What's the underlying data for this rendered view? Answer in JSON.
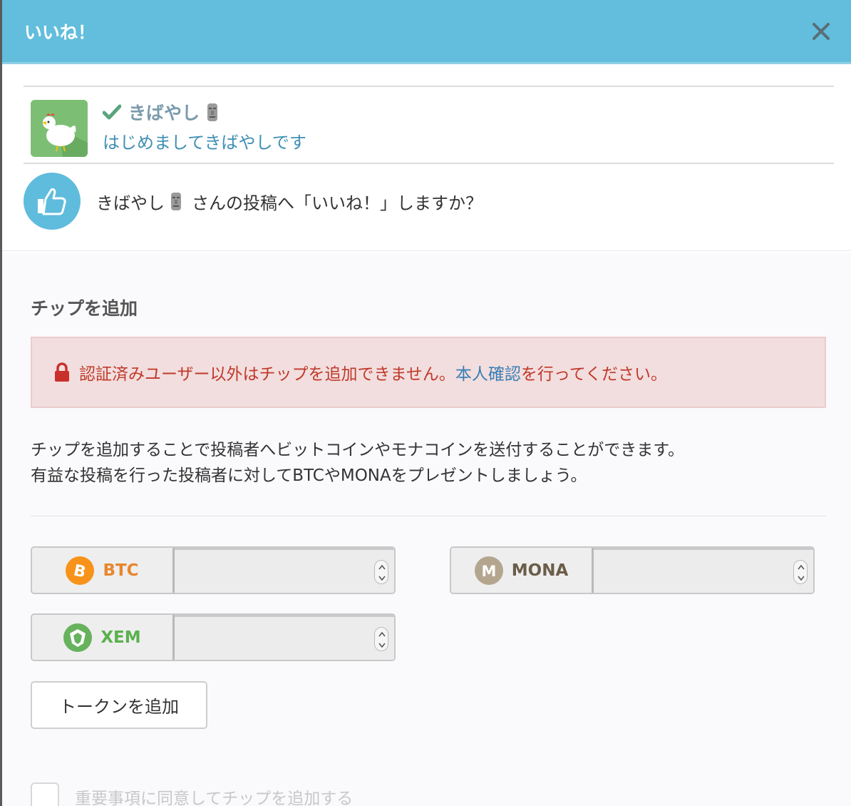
{
  "header": {
    "title": "いいね！"
  },
  "author": {
    "name": "きばやし",
    "bio": "はじめましてきばやしです"
  },
  "like": {
    "name": "きばやし",
    "suffix": "さんの投稿へ「いいね！」しますか？"
  },
  "tip": {
    "title": "チップを追加",
    "alert_text": "認証済みユーザー以外はチップを追加できません。",
    "alert_link": "本人確認",
    "alert_tail": "を行ってください。",
    "desc_line1": "チップを追加することで投稿者へビットコインやモナコインを送付することができます。",
    "desc_line2": "有益な投稿を行った投稿者に対してBTCやMONAをプレゼントしましょう。",
    "coins": [
      {
        "label": "BTC",
        "color": "#e8862d",
        "icon_color": "#f7931a",
        "value": ""
      },
      {
        "label": "MONA",
        "color": "#6b5d4a",
        "icon_color": "#b4a68e",
        "value": ""
      },
      {
        "label": "XEM",
        "color": "#5ab04e",
        "icon_color": "#67b25d",
        "value": ""
      }
    ],
    "add_token": "トークンを追加",
    "agree": "重要事項に同意してチップを追加する"
  }
}
